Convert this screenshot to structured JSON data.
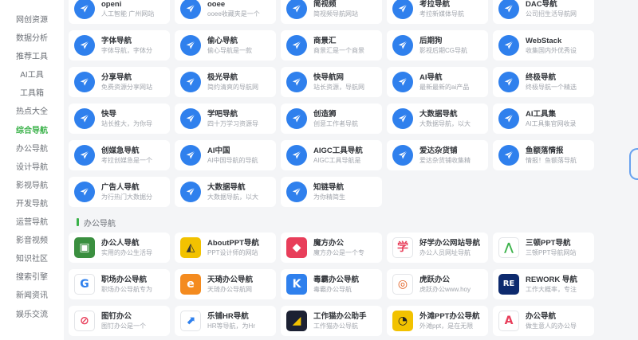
{
  "sidebar": {
    "items": [
      "网创资源",
      "数据分析",
      "推荐工具",
      "AI工具",
      "工具箱",
      "热点大全",
      "综合导航",
      "办公导航",
      "设计导航",
      "影视导航",
      "开发导航",
      "运营导航",
      "影音视频",
      "知识社区",
      "搜索引擎",
      "新闻资讯",
      "娱乐交流"
    ],
    "active_index": 6
  },
  "nav_cards": [
    {
      "title": "openi",
      "desc": "人工智能 广州网站"
    },
    {
      "title": "ooee",
      "desc": "ooee收藏夹是一个"
    },
    {
      "title": "简视频",
      "desc": "简视频导航网站"
    },
    {
      "title": "考拉导航",
      "desc": "考拉新媒体导航"
    },
    {
      "title": "DAC导航",
      "desc": "公司招生活导航网"
    },
    {
      "title": "字体导航",
      "desc": "字体导航，字体分"
    },
    {
      "title": "偷心导航",
      "desc": "偷心导航是一款"
    },
    {
      "title": "商景汇",
      "desc": "商景汇是一个商景"
    },
    {
      "title": "后期狗",
      "desc": "影视后期CG导航"
    },
    {
      "title": "WebStack",
      "desc": "收集国内外优秀设"
    },
    {
      "title": "分享导航",
      "desc": "免费资源分享网站"
    },
    {
      "title": "极光导航",
      "desc": "简约清爽的导航网"
    },
    {
      "title": "快导航网",
      "desc": "站长资源，导航网"
    },
    {
      "title": "AI导航",
      "desc": "最新最新的ai产品"
    },
    {
      "title": "终极导航",
      "desc": "终极导航一个精选"
    },
    {
      "title": "快导",
      "desc": "站长推大，为你导"
    },
    {
      "title": "学吧导航",
      "desc": "四十万学习资源导"
    },
    {
      "title": "创造狮",
      "desc": "创意工作者导航"
    },
    {
      "title": "大数据导航",
      "desc": "大数据导航，以大"
    },
    {
      "title": "AI工具集",
      "desc": "AI工具集官网收录"
    },
    {
      "title": "创媒急导航",
      "desc": "考拉创媒急是一个"
    },
    {
      "title": "AI中国",
      "desc": "AI中国导航的导航"
    },
    {
      "title": "AIGC工具导航",
      "desc": "AIGC工具导航是"
    },
    {
      "title": "爱达杂货铺",
      "desc": "爱达杂货铺收集精"
    },
    {
      "title": "鱼额落情报",
      "desc": "情报！鱼额落导航"
    },
    {
      "title": "广告人导航",
      "desc": "为行热门大数据分"
    },
    {
      "title": "大数据导航",
      "desc": "大数据导航，以大"
    },
    {
      "title": "知链导航",
      "desc": "为你精简生"
    }
  ],
  "section": {
    "title": "办公导航"
  },
  "office_cards": [
    {
      "title": "办公人导航",
      "desc": "实用的办公生活导"
    },
    {
      "title": "AboutPPT导航",
      "desc": "PPT设计师的网站"
    },
    {
      "title": "魔方办公",
      "desc": "魔方办公是一个专"
    },
    {
      "title": "好学办公网站导航",
      "desc": "办公人员网址导航"
    },
    {
      "title": "三顿PPT导航",
      "desc": "三顿PPT导航网站"
    },
    {
      "title": "职场办公导航",
      "desc": "职场办公导航专为"
    },
    {
      "title": "天琦办公导航",
      "desc": "天琦办公导航网"
    },
    {
      "title": "毒霸办公导航",
      "desc": "毒霸办公导航"
    },
    {
      "title": "虎跃办公",
      "desc": "虎跃办公www.hoy"
    },
    {
      "title": "REWORK 导航",
      "desc": "工作大概率，专注"
    },
    {
      "title": "图钉办公",
      "desc": "图钉办公是一个"
    },
    {
      "title": "乐铺HR导航",
      "desc": "HR等导航，为Hr"
    },
    {
      "title": "工作猫办公助手",
      "desc": "工作猫办公导航"
    },
    {
      "title": "外滩PPT办公导航",
      "desc": "外滩ppt，是在无限"
    },
    {
      "title": "办公导航",
      "desc": "做生意人的办公导"
    }
  ],
  "colors": {
    "accent_green": "#3bb24a",
    "nav_icon_blue": "#2f80ed",
    "office_icon_colors": [
      "#3a8f3f",
      "#f2c200",
      "#e83e5a",
      "#ffffff",
      "#ffffff",
      "#ffffff",
      "#f48b1f",
      "#2f80ed",
      "#ffffff",
      "#0d2a6e",
      "#ffffff",
      "#ffffff",
      "#1c2133",
      "#f2c200",
      "#ffffff"
    ],
    "office_glyph_colors": [
      "#ffffff",
      "#333333",
      "#ffffff",
      "#e83e5a",
      "#3bb24a",
      "#2f80ed",
      "#ffffff",
      "#ffffff",
      "#e05a1a",
      "#ffffff",
      "#e83e5a",
      "#2f80ed",
      "#f2c200",
      "#222222",
      "#e83e5a"
    ]
  },
  "icons": {
    "nav": "paper-plane-icon",
    "office": [
      "office-person-icon",
      "about-ppt-icon",
      "magic-cube-icon",
      "xue-char-icon",
      "mountain-icon",
      "g-box-icon",
      "e-letter-icon",
      "k-letter-icon",
      "tiger-icon",
      "re-badge-icon",
      "pin-icon",
      "hr-chart-icon",
      "cat-icon",
      "bubble-icon",
      "triangle-a-icon"
    ],
    "office_glyphs": [
      "▣",
      "◭",
      "◆",
      "学",
      "⋀",
      "G",
      "e",
      "K",
      "◎",
      "RE",
      "⊘",
      "⬈",
      "◢",
      "◔",
      "A"
    ]
  }
}
